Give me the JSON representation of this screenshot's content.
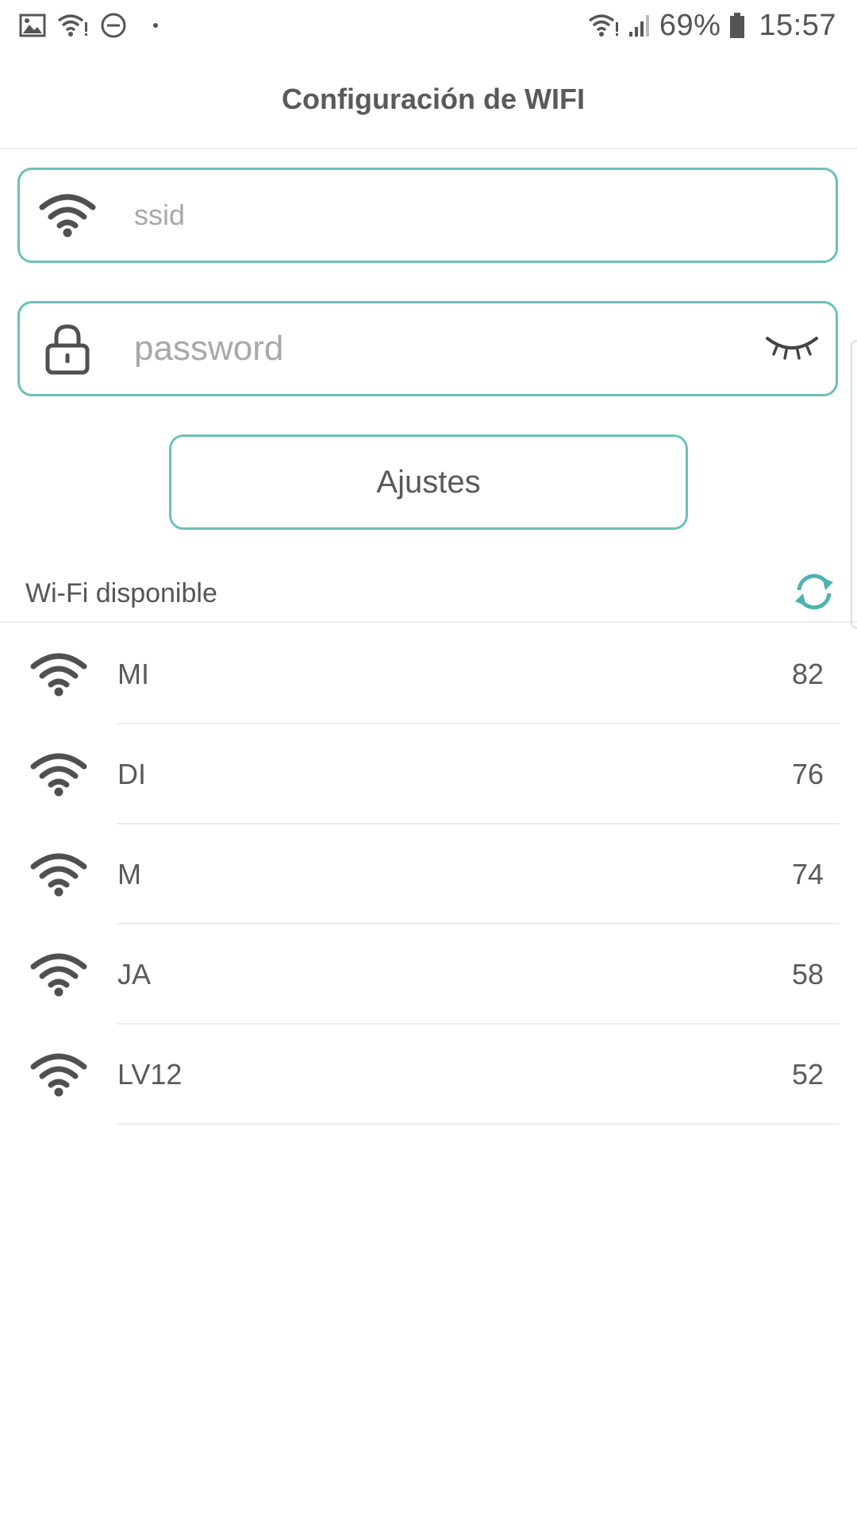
{
  "status_bar": {
    "battery_percent": "69%",
    "time": "15:57",
    "icons": [
      "image-icon",
      "wifi-alert-icon",
      "do-not-disturb-icon",
      "dot-icon",
      "wifi-signal-icon",
      "cell-signal-icon",
      "battery-icon"
    ]
  },
  "header": {
    "title": "Configuración de WIFI"
  },
  "form": {
    "ssid_placeholder": "ssid",
    "ssid_value": "",
    "password_placeholder": "password",
    "password_value": "",
    "settings_button_label": "Ajustes"
  },
  "section": {
    "title": "Wi-Fi disponible"
  },
  "wifi_networks": [
    {
      "name": "MI",
      "signal": "82"
    },
    {
      "name": "DI",
      "signal": "76"
    },
    {
      "name": "M",
      "signal": "74"
    },
    {
      "name": "JA",
      "signal": "58"
    },
    {
      "name": "LV12",
      "signal": "52"
    }
  ],
  "colors": {
    "accent": "#6cc0bb",
    "refresh": "#4fb3b0",
    "text": "#555555",
    "divider": "#ececec"
  }
}
